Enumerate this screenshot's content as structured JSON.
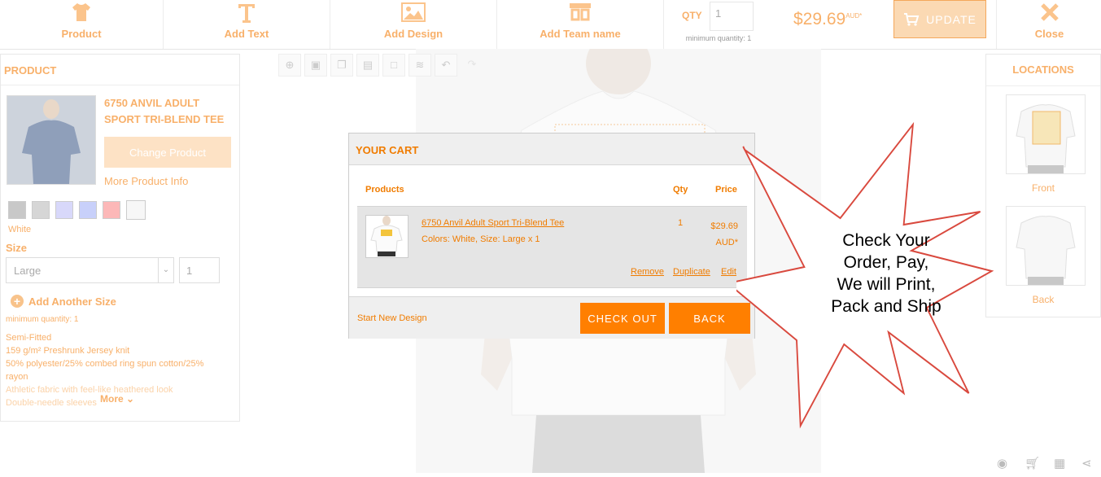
{
  "toolbar": {
    "product_label": "Product",
    "add_text_label": "Add Text",
    "add_design_label": "Add Design",
    "team_icon_text": "NAMES 00",
    "add_team_label": "Add Team name",
    "qty_label": "QTY",
    "qty_value": "1",
    "min_qty": "minimum quantity: 1",
    "price": "$29.69",
    "price_currency": "AUD*",
    "update_label": "UPDATE",
    "close_label": "Close"
  },
  "product_panel": {
    "heading": "PRODUCT",
    "name": "6750 ANVIL ADULT SPORT TRI-BLEND TEE",
    "change_button": "Change Product",
    "more_info": "More Product Info",
    "swatches": [
      "#c8c8c8",
      "#d6d6d6",
      "#d8d8fa",
      "#c8d0fa",
      "#fcb8b8",
      "#f7f7f7"
    ],
    "selected_color": "White",
    "size_label": "Size",
    "size_value": "Large",
    "size_qty": "1",
    "add_size": "Add Another Size",
    "min_qty": "minimum quantity: 1",
    "desc_lines": [
      "Semi-Fitted",
      "159 g/m² Preshrunk Jersey knit",
      "50% polyester/25% combed ring spun cotton/25%",
      "rayon"
    ],
    "desc_faded_lines": [
      "Athletic fabric with feel-like heathered look",
      "Double-needle sleeves"
    ],
    "more_link": "More"
  },
  "locations_panel": {
    "heading": "LOCATIONS",
    "front_label": "Front",
    "back_label": "Back"
  },
  "cart": {
    "title": "YOUR CART",
    "col_products": "Products",
    "col_qty": "Qty",
    "col_price": "Price",
    "item": {
      "name": "6750 Anvil Adult Sport Tri-Blend Tee",
      "options": "Colors: White, Size: Large x 1",
      "qty": "1",
      "price": "$29.69",
      "currency": "AUD*",
      "remove": "Remove",
      "duplicate": "Duplicate",
      "edit": "Edit"
    },
    "start_new": "Start New Design",
    "checkout": "CHECK OUT",
    "back": "BACK"
  },
  "callout": {
    "lines": [
      "Check Your",
      "Order, Pay,",
      "We will Print,",
      "Pack and Ship"
    ]
  },
  "colors": {
    "accent": "#f07c00",
    "accent_faded": "#f8b06a",
    "button": "#ff7f00",
    "callout_stroke": "#d9493e"
  }
}
